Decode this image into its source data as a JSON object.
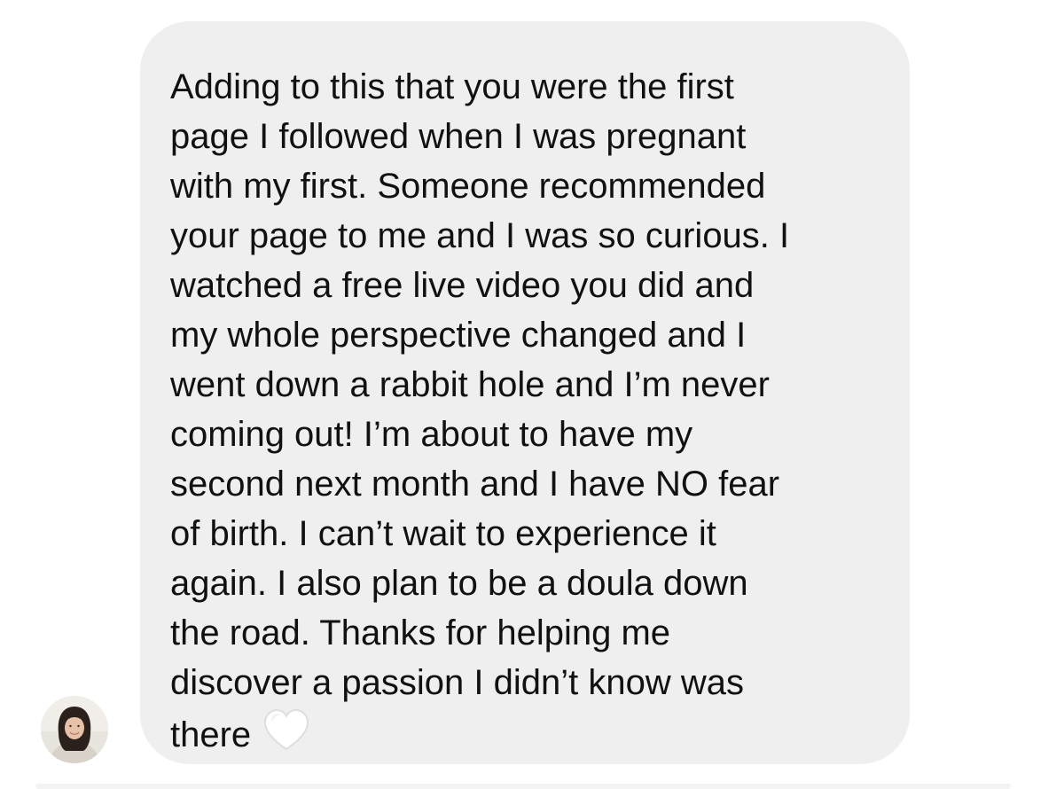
{
  "message": {
    "lines": [
      "Adding to this that you were the first",
      "page I followed when I was pregnant",
      "with my first. Someone recommended",
      "your page to me and I was so curious. I",
      "watched a free live video you did and",
      "my whole perspective changed and I",
      "went down a rabbit hole and I’m never",
      "coming out! I’m about to have my",
      "second next month and I have NO fear",
      "of birth. I can’t wait to experience it",
      "again. I also plan to be a doula down",
      "the road. Thanks for helping me",
      "discover a passion I didn’t know was",
      "there"
    ],
    "trailing_icon": "white-heart-icon"
  },
  "sender": {
    "avatar_icon": "avatar-photo"
  },
  "colors": {
    "bubble_background": "#efefef",
    "text": "#111111",
    "page_background": "#ffffff"
  }
}
